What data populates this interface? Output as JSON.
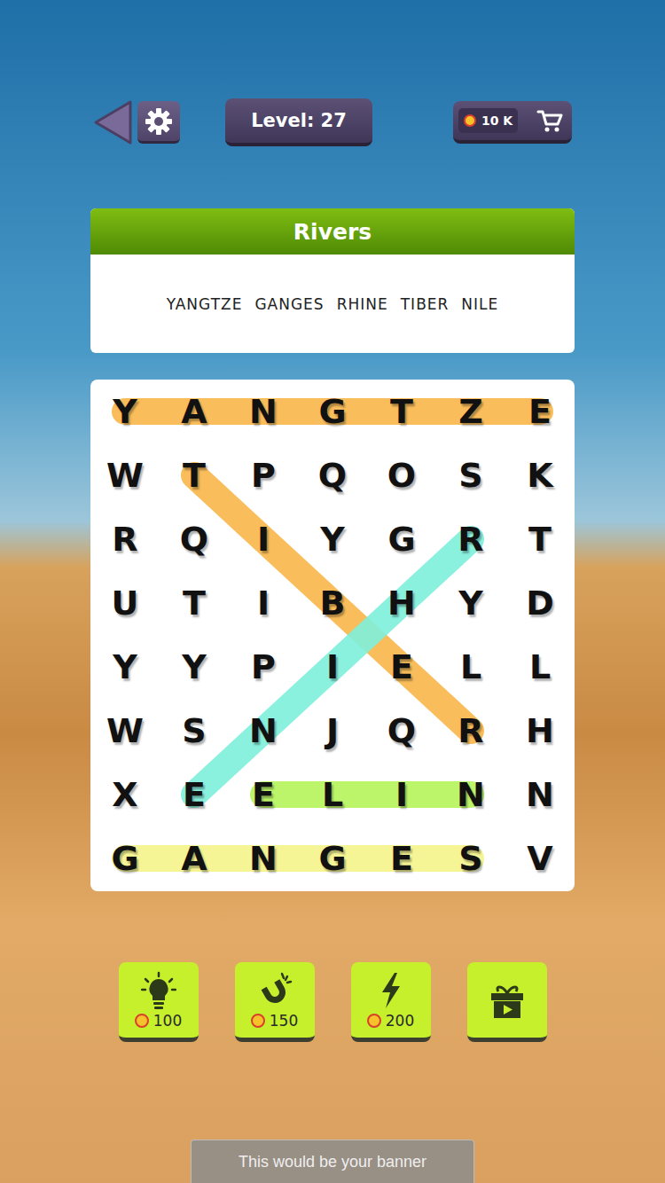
{
  "top_bar": {
    "level": "Level: 27",
    "coins": "10 K"
  },
  "puzzle": {
    "title": "Rivers",
    "words": [
      "YANGTZE",
      "GANGES",
      "RHINE",
      "TIBER",
      "NILE"
    ]
  },
  "grid": {
    "rows": [
      [
        "Y",
        "A",
        "N",
        "G",
        "T",
        "Z",
        "E"
      ],
      [
        "W",
        "T",
        "P",
        "Q",
        "O",
        "S",
        "K"
      ],
      [
        "R",
        "Q",
        "I",
        "Y",
        "G",
        "R",
        "T"
      ],
      [
        "U",
        "T",
        "I",
        "B",
        "H",
        "Y",
        "D"
      ],
      [
        "Y",
        "Y",
        "P",
        "I",
        "E",
        "L",
        "L"
      ],
      [
        "W",
        "S",
        "N",
        "J",
        "Q",
        "R",
        "H"
      ],
      [
        "X",
        "E",
        "E",
        "L",
        "I",
        "N",
        "N"
      ],
      [
        "G",
        "A",
        "N",
        "G",
        "E",
        "S",
        "V"
      ]
    ],
    "highlights": [
      {
        "word": "YANGTZE",
        "color": "#f9b64a",
        "from": [
          0,
          0
        ],
        "to": [
          0,
          6
        ]
      },
      {
        "word": "TIBER",
        "color": "#f9b64a",
        "from": [
          1,
          1
        ],
        "to": [
          5,
          5
        ]
      },
      {
        "word": "RHINE",
        "color": "#7ff0dc",
        "from": [
          2,
          5
        ],
        "to": [
          6,
          1
        ]
      },
      {
        "word": "NILE",
        "color": "#b6f55a",
        "from": [
          6,
          5
        ],
        "to": [
          6,
          2
        ]
      },
      {
        "word": "GANGES",
        "color": "#f6f58a",
        "from": [
          7,
          0
        ],
        "to": [
          7,
          5
        ]
      }
    ]
  },
  "boosters": [
    {
      "kind": "hint",
      "price": "100"
    },
    {
      "kind": "magnet",
      "price": "150"
    },
    {
      "kind": "bolt",
      "price": "200"
    },
    {
      "kind": "reward"
    }
  ],
  "banner": "This would be your banner"
}
